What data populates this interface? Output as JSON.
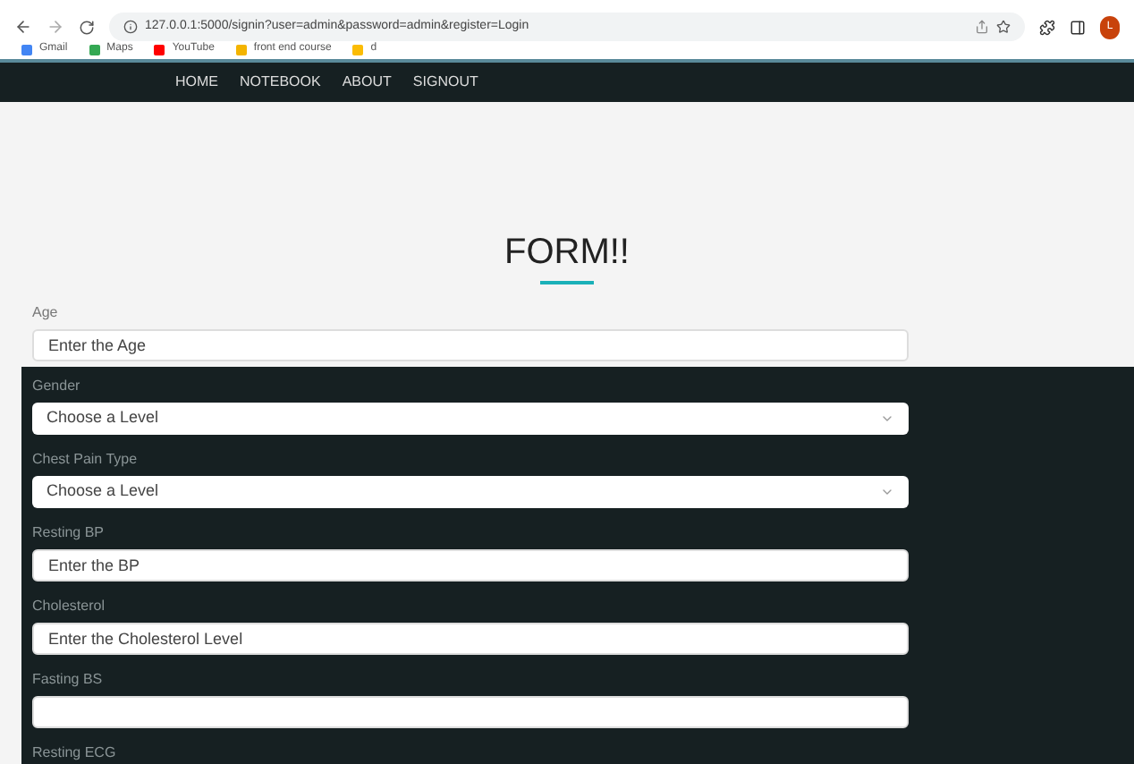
{
  "browser": {
    "url": "127.0.0.1:5000/signin?user=admin&password=admin&register=Login",
    "bookmarks": [
      {
        "label": "Gmail",
        "color": "#4285f4"
      },
      {
        "label": "Maps",
        "color": "#34a853"
      },
      {
        "label": "YouTube",
        "color": "#ff0000"
      },
      {
        "label": "front end course",
        "color": "#f4b400"
      },
      {
        "label": "d",
        "color": "#fbbc05"
      }
    ],
    "profile": "L"
  },
  "nav": [
    "HOME",
    "NOTEBOOK",
    "ABOUT",
    "SIGNOUT"
  ],
  "heading": "FORM!!",
  "sections": [
    {
      "kind": "light",
      "fields": [
        {
          "label": "Age",
          "kind": "input",
          "placeholder": "Enter the Age"
        }
      ]
    },
    {
      "kind": "dark",
      "fields": [
        {
          "label": "Gender",
          "kind": "select",
          "value": "Choose a Level"
        },
        {
          "label": "Chest Pain Type",
          "kind": "select",
          "value": "Choose a Level"
        },
        {
          "label": "Resting BP",
          "kind": "input",
          "placeholder": "Enter the BP"
        },
        {
          "label": "Cholesterol",
          "kind": "input",
          "placeholder": "Enter the Cholesterol Level"
        },
        {
          "label": "Fasting BS",
          "kind": "input"
        },
        {
          "label": "Resting ECG",
          "kind": "cut"
        }
      ]
    }
  ]
}
